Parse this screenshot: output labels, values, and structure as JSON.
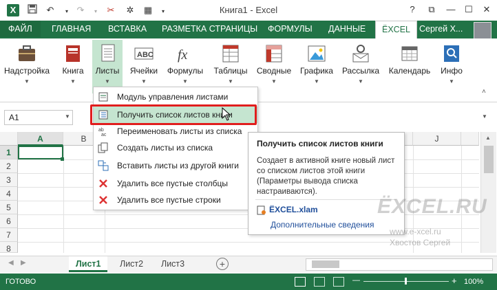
{
  "title_bar": {
    "title": "Книга1 - Excel",
    "quick_access": [
      "excel-logo-icon",
      "save-icon",
      "undo-icon",
      "redo-icon",
      "cut-icon",
      "customize-icon",
      "settings-icon"
    ],
    "window_buttons": {
      "help": "?",
      "restore": "⧉",
      "minimize": "—",
      "maximize": "☐",
      "close": "✕"
    }
  },
  "tabs": [
    "ФАЙЛ",
    "ГЛАВНАЯ",
    "ВСТАВКА",
    "РАЗМЕТКА СТРАНИЦЫ",
    "ФОРМУЛЫ",
    "ДАННЫЕ",
    "ЁXCEL"
  ],
  "active_tab": "ЁXCEL",
  "user_name": "Сергей Х...",
  "ribbon": {
    "buttons": [
      "Надстройка",
      "Книга",
      "Листы",
      "Ячейки",
      "Формулы",
      "Таблицы",
      "Сводные",
      "Графика",
      "Рассылка",
      "Календарь",
      "Инфо"
    ],
    "selected": "Листы"
  },
  "formula_bar": {
    "name_box": "A1"
  },
  "grid": {
    "columns": [
      "A",
      "B",
      "J"
    ],
    "rows": [
      "1",
      "2",
      "3",
      "4",
      "5",
      "6",
      "7",
      "8"
    ]
  },
  "menu": {
    "items": [
      {
        "label": "Модуль управления листами",
        "icon": "sheet-manager-icon"
      },
      {
        "label": "Получить список листов книги",
        "icon": "sheet-list-icon",
        "highlighted": true
      },
      {
        "label": "Переименовать листы из списка",
        "icon": "rename-icon"
      },
      {
        "label": "Создать листы из списка",
        "icon": "create-sheets-icon"
      },
      {
        "label": "Вставить листы из другой книги",
        "icon": "insert-sheets-icon"
      },
      {
        "label": "Удалить все пустые столбцы",
        "icon": "delete-columns-icon"
      },
      {
        "label": "Удалить все пустые строки",
        "icon": "delete-rows-icon"
      }
    ]
  },
  "tooltip": {
    "title": "Получить список листов книги",
    "description": "Создает в активной книге новый лист со списком листов этой книги (Параметры вывода списка настраиваются).",
    "addin": "ЁXCEL.xlam",
    "more": "Дополнительные сведения"
  },
  "watermark": {
    "logo": "ЁXCEL.RU",
    "site": "www.e-xcel.ru",
    "author": "Хвостов Сергей"
  },
  "sheets": [
    "Лист1",
    "Лист2",
    "Лист3"
  ],
  "active_sheet": "Лист1",
  "status": {
    "ready": "ГОТОВО",
    "zoom": "100%",
    "minus": "—",
    "plus": "+"
  },
  "colors": {
    "accent": "#217346",
    "selection": "#c5e5d0",
    "highlight_box": "#e11d1d"
  }
}
